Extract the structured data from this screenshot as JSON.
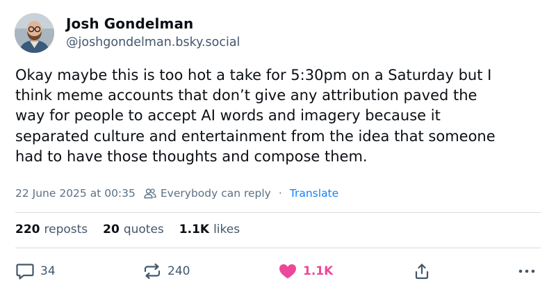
{
  "author": {
    "display_name": "Josh Gondelman",
    "handle": "@joshgondelman.bsky.social",
    "avatar": "avatar-photo"
  },
  "post": {
    "lines": [
      "Okay maybe this is too hot a take for 5:30pm on a Saturday but I",
      "think meme accounts that don’t give any attribution paved the",
      "way for people to accept AI words and imagery because it",
      "separated culture and entertainment from the idea that someone",
      "had to have those thoughts and compose them."
    ]
  },
  "meta": {
    "timestamp": "22 June 2025 at 00:35",
    "reply_setting": "Everybody can reply",
    "separator": "·",
    "translate_label": "Translate",
    "reply_setting_icon": "people-icon"
  },
  "stats": {
    "reposts_count": "220",
    "reposts_label": "reposts",
    "quotes_count": "20",
    "quotes_label": "quotes",
    "likes_count": "1.1K",
    "likes_label": "likes"
  },
  "actions": {
    "reply_icon": "reply-bubble-icon",
    "reply_count": "34",
    "repost_icon": "repost-icon",
    "repost_count": "240",
    "like_icon": "heart-icon",
    "like_count": "1.1K",
    "like_state": "liked",
    "share_icon": "share-icon",
    "more_icon": "more-horizontal-icon"
  },
  "colors": {
    "text": "#0b0f14",
    "secondary_text": "#42576c",
    "meta_text": "#5b7085",
    "link": "#1083fe",
    "like_active": "#ec4899",
    "divider": "#d4dbe2"
  }
}
